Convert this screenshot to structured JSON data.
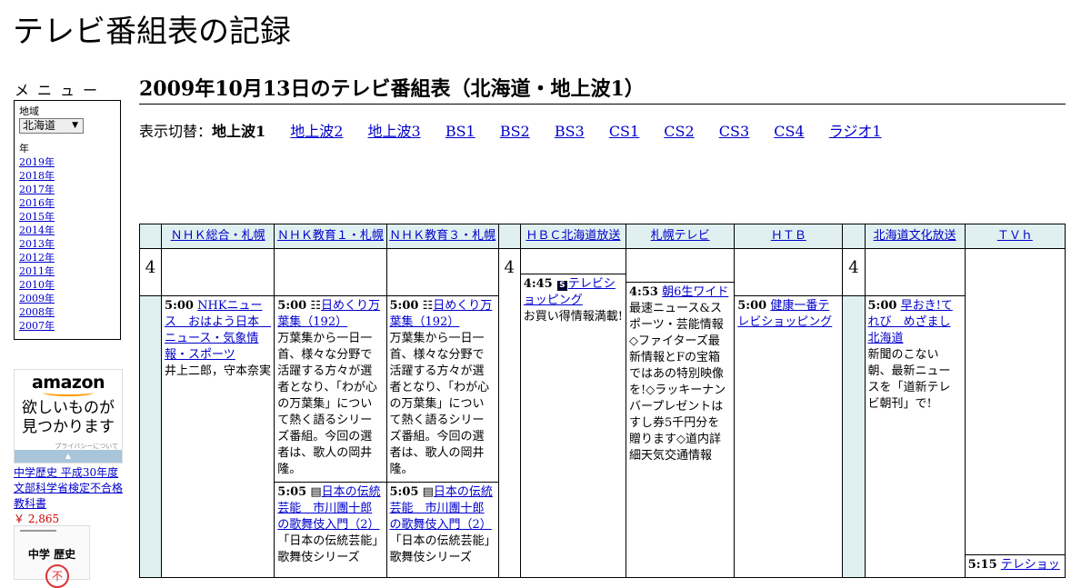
{
  "site": {
    "title": "テレビ番組表の記録"
  },
  "menu": {
    "title": "メニュー",
    "region_label": "地域",
    "region_value": "北海道",
    "year_label": "年",
    "years": [
      "2019年",
      "2018年",
      "2017年",
      "2016年",
      "2015年",
      "2014年",
      "2013年",
      "2012年",
      "2011年",
      "2010年",
      "2009年",
      "2008年",
      "2007年"
    ]
  },
  "ad": {
    "logo": "amazon",
    "slogan_1": "欲しいものが",
    "slogan_2": "見つかります",
    "privacy": "プライバシーについて",
    "product_title": "中学歴史 平成30年度文部科学省検定不合格教科書",
    "product_price": "￥ 2,865",
    "book_title": "中学 歴史",
    "book_stamp": "不"
  },
  "page": {
    "title": "2009年10月13日のテレビ番組表（北海道・地上波1）"
  },
  "switcher": {
    "label": "表示切替：",
    "current": "地上波1",
    "links": [
      "地上波2",
      "地上波3",
      "BS1",
      "BS2",
      "BS3",
      "CS1",
      "CS2",
      "CS3",
      "CS4",
      "ラジオ1"
    ]
  },
  "schedule": {
    "hour": "4",
    "channels": [
      "ＮＨＫ総合・札幌",
      "ＮＨＫ教育１・札幌",
      "ＮＨＫ教育３・札幌",
      "ＨＢＣ北海道放送",
      "札幌テレビ",
      "ＨＴＢ",
      "北海道文化放送",
      "ＴＶｈ"
    ],
    "programs": {
      "nhk_g_1": {
        "time": "5:00",
        "title": "NHKニュース　おはよう日本　ニュース・気象情報・スポーツ",
        "desc": "井上二郎，守本奈実"
      },
      "nhk_e1_1": {
        "time": "5:00",
        "title": "日めくり万葉集（192）",
        "desc": "万葉集から一日一首、様々な分野で活躍する方々が選者となり、「わが心の万葉集」について熱く語るシリーズ番組。今回の選者は、歌人の岡井隆。"
      },
      "nhk_e1_2": {
        "time": "5:05",
        "title": "日本の伝統芸能　市川團十郎の歌舞伎入門（2）",
        "desc": "「日本の伝統芸能」歌舞伎シリーズ"
      },
      "nhk_e3_1": {
        "time": "5:00",
        "title": "日めくり万葉集（192）",
        "desc": "万葉集から一日一首、様々な分野で活躍する方々が選者となり、「わが心の万葉集」について熱く語るシリーズ番組。今回の選者は、歌人の岡井隆。"
      },
      "nhk_e3_2": {
        "time": "5:05",
        "title": "日本の伝統芸能　市川團十郎の歌舞伎入門（2）",
        "desc": "「日本の伝統芸能」歌舞伎シリーズ"
      },
      "hbc_1": {
        "time": "4:45",
        "icon": "S",
        "title": "テレビショッピング",
        "desc": "お買い得情報満載!"
      },
      "stv_1": {
        "time": "4:53",
        "title": "朝6生ワイド",
        "desc": "最速ニュース&スポーツ・芸能情報◇ファイターズ最新情報とFの宝箱ではあの特別映像を!◇ラッキーナンバープレゼントはすし券5千円分を贈ります◇道内詳細天気交通情報"
      },
      "htb_1": {
        "time": "5:00",
        "title": "健康一番テレビショッピング",
        "desc": ""
      },
      "uhb_1": {
        "time": "5:00",
        "title": "早おき!てれび　めざまし北海道",
        "desc": "新聞のこない朝、最新ニュースを「道新テレビ朝刊」で!"
      },
      "tvh_1": {
        "time": "5:15",
        "title": "テレショッ",
        "desc": ""
      }
    }
  }
}
